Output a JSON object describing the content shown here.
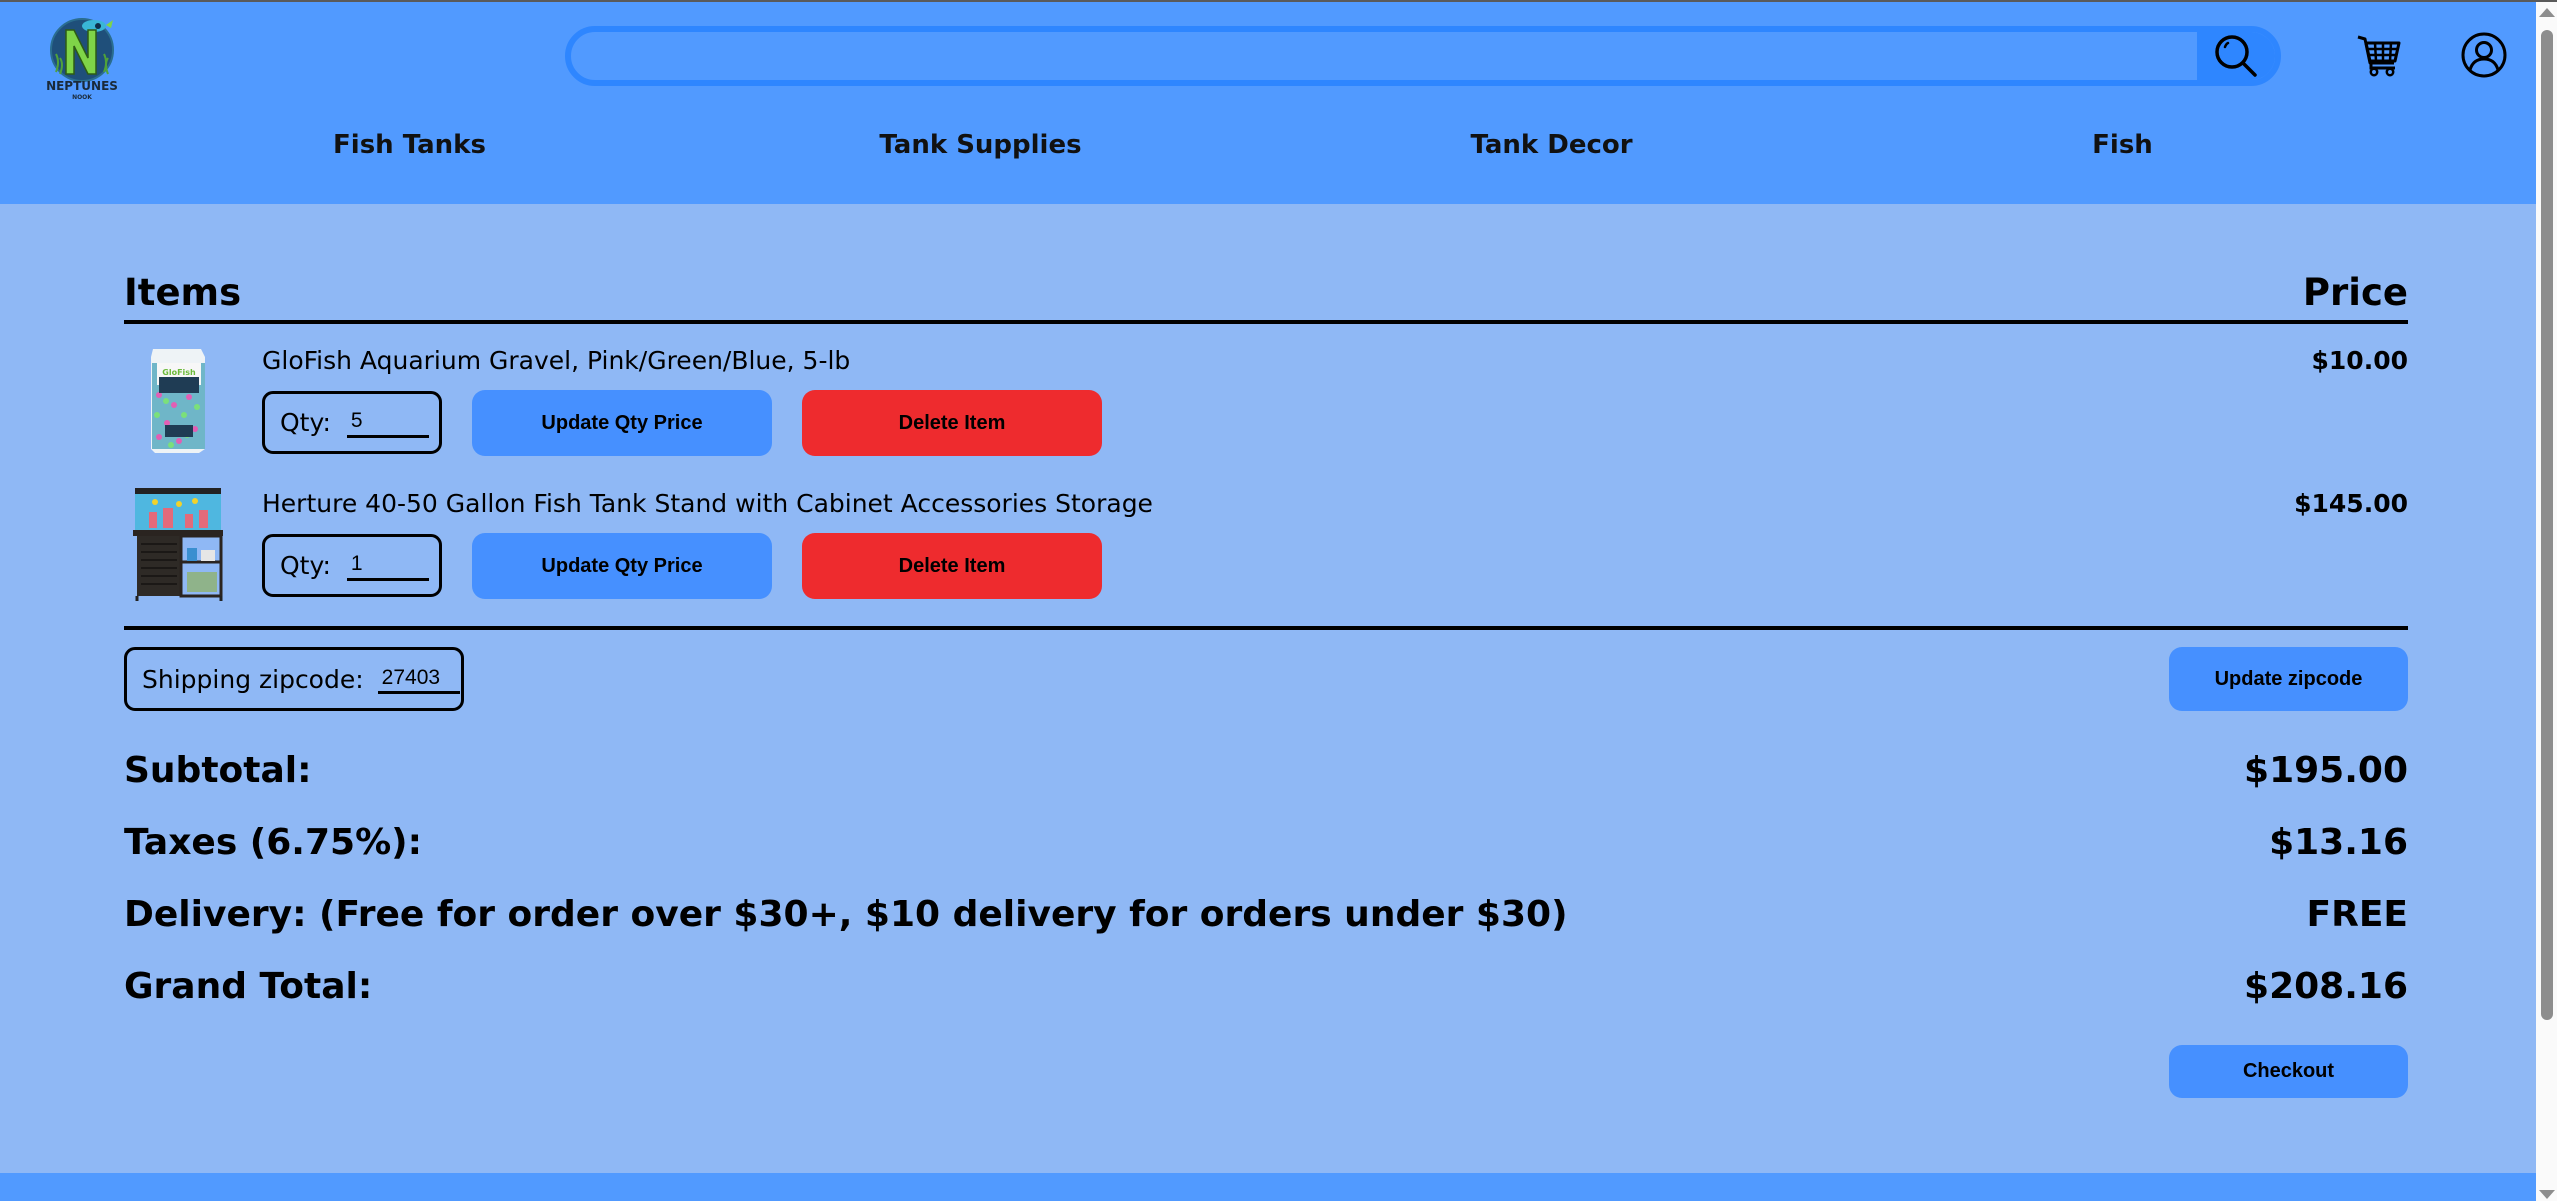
{
  "brand": {
    "name": "Neptune's Nook",
    "logo_line1": "NEPTUNES",
    "logo_line2": "NOOK",
    "colors": {
      "header_bg": "#519aff",
      "content_bg": "#8fb8f5",
      "search_border": "#2e86ff",
      "button_blue": "#4690ff",
      "button_red": "#ee2b2e"
    }
  },
  "header": {
    "search": {
      "value": "",
      "placeholder": "",
      "icon": "search-icon"
    },
    "cart_icon": "cart-icon",
    "account_icon": "user-account-icon"
  },
  "nav": {
    "items": [
      {
        "label": "Fish Tanks"
      },
      {
        "label": "Tank Supplies"
      },
      {
        "label": "Tank Decor"
      },
      {
        "label": "Fish"
      }
    ]
  },
  "cart": {
    "columns": {
      "items": "Items",
      "price": "Price"
    },
    "qty_label": "Qty:",
    "update_qty_label": "Update Qty Price",
    "delete_label": "Delete Item",
    "items": [
      {
        "title": "GloFish Aquarium Gravel, Pink/Green/Blue, 5-lb",
        "qty": "5",
        "price": "$10.00",
        "image": "glofish-gravel-bag"
      },
      {
        "title": "Herture 40-50 Gallon Fish Tank Stand with Cabinet Accessories Storage",
        "qty": "1",
        "price": "$145.00",
        "image": "fish-tank-stand-cabinet"
      }
    ]
  },
  "shipping": {
    "zip_label": "Shipping zipcode:",
    "zip_value": "27403",
    "update_zip_label": "Update zipcode"
  },
  "summary": {
    "subtotal_label": "Subtotal:",
    "subtotal_value": "$195.00",
    "taxes_label": "Taxes (6.75%):",
    "taxes_value": "$13.16",
    "delivery_label": "Delivery: (Free for order over $30+, $10 delivery for orders under $30)",
    "delivery_value": "FREE",
    "grand_total_label": "Grand Total:",
    "grand_total_value": "$208.16",
    "checkout_label": "Checkout"
  }
}
